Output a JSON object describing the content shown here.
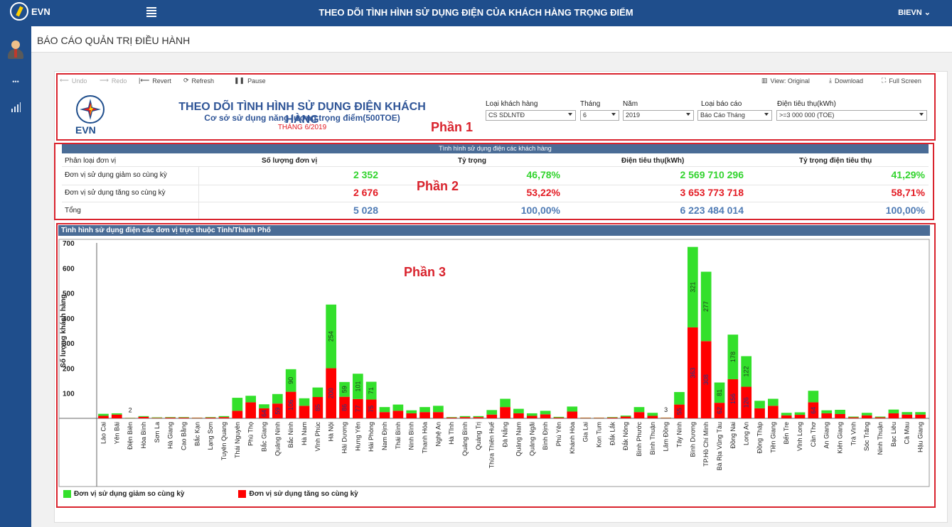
{
  "topbar": {
    "brand": "EVN",
    "app_title": "THEO DÕI TÌNH HÌNH SỬ DỤNG ĐIỆN CỦA KHÁCH HÀNG TRỌNG ĐIỂM",
    "user": "BIEVN",
    "user_caret": "⌄"
  },
  "sidebar": {
    "icons": [
      "user-avatar-icon",
      "ellipsis-icon",
      "bar-chart-icon"
    ],
    "glyph_more": "•••"
  },
  "page": {
    "heading": "BÁO CÁO QUẢN TRỊ ĐIỀU HÀNH"
  },
  "toolbar": {
    "undo": "Undo",
    "redo": "Redo",
    "revert": "Revert",
    "refresh": "Refresh",
    "pause": "Pause",
    "view": "View: Original",
    "download": "Download",
    "fullscreen": "Full Screen"
  },
  "report": {
    "logo_text": "EVN",
    "title": "THEO DÕI TÌNH HÌNH SỬ DỤNG ĐIỆN KHÁCH HÀNG",
    "subtitle": "Cơ sở sử dụng năng lượng trọng điểm(500TOE)",
    "month": "THÁNG 6/2019"
  },
  "annotations": {
    "part1": "Phần 1",
    "part2": "Phần 2",
    "part3": "Phần 3"
  },
  "filters": {
    "customer_type": {
      "label": "Loại khách hàng",
      "value": "CS SDLNTĐ"
    },
    "month": {
      "label": "Tháng",
      "value": "6"
    },
    "year": {
      "label": "Năm",
      "value": "2019"
    },
    "report_type": {
      "label": "Loại báo cáo",
      "value": "Báo Cáo Tháng"
    },
    "consumption": {
      "label": "Điện tiêu thụ(kWh)",
      "value": ">=3 000 000 (TOE)"
    }
  },
  "summary": {
    "header": "Tình hình sử dụng điện các khách hàng",
    "columns": [
      "Phân loại đơn vị",
      "Số lượng đơn vị",
      "Tỷ trọng",
      "Điện tiêu thụ(kWh)",
      "Tỷ trọng điện tiêu thụ"
    ],
    "rows": [
      {
        "label": "Đơn vị sử dụng giảm so cùng kỳ",
        "count": "2 352",
        "ratio": "46,78%",
        "energy": "2 569 710 296",
        "energy_ratio": "41,29%"
      },
      {
        "label": "Đơn vị sử dụng tăng so cùng kỳ",
        "count": "2 676",
        "ratio": "53,22%",
        "energy": "3 653 773 718",
        "energy_ratio": "58,71%"
      },
      {
        "label": "Tổng",
        "count": "5 028",
        "ratio": "100,00%",
        "energy": "6 223 484 014",
        "energy_ratio": "100,00%"
      }
    ]
  },
  "chart_section": {
    "header": "Tình hình sử dụng điện các đơn vị trực thuộc Tỉnh/Thành Phố"
  },
  "chart_data": {
    "type": "bar",
    "stacked": true,
    "title": "Tình hình sử dụng điện các đơn vị trực thuộc Tỉnh/Thành Phố",
    "ylabel": "Số lượng khách hàng",
    "ylim": [
      0,
      700
    ],
    "yticks": [
      100,
      200,
      300,
      400,
      500,
      600,
      700
    ],
    "categories": [
      "Lào Cai",
      "Yên Bái",
      "Điện Biên",
      "Hòa Bình",
      "Sơn La",
      "Hà Giang",
      "Cao Bằng",
      "Bắc Kạn",
      "Lạng Sơn",
      "Tuyên Quang",
      "Thái Nguyên",
      "Phú Thọ",
      "Bắc Giang",
      "Quảng Ninh",
      "Bắc Ninh",
      "Hà Nam",
      "Vĩnh Phúc",
      "Hà Nội",
      "Hải Dương",
      "Hưng Yên",
      "Hải Phòng",
      "Nam Định",
      "Thái Bình",
      "Ninh Bình",
      "Thanh Hóa",
      "Nghệ An",
      "Hà Tĩnh",
      "Quảng Bình",
      "Quảng Trị",
      "Thừa Thiên Huế",
      "Đà Nẵng",
      "Quảng Nam",
      "Quảng Ngãi",
      "Bình Định",
      "Phú Yên",
      "Khánh Hòa",
      "Gia Lai",
      "Kon Tum",
      "Đắk Lắk",
      "Đắk Nông",
      "Bình Phước",
      "Bình Thuận",
      "Lâm Đồng",
      "Tây Ninh",
      "Bình Dương",
      "TP.Hồ Chí Minh",
      "Bà Rịa Vũng Tàu",
      "Đồng Nai",
      "Long An",
      "Đồng Tháp",
      "Tiền Giang",
      "Bến Tre",
      "Vĩnh Long",
      "Cần Thơ",
      "An Giang",
      "Kiên Giang",
      "Trà Vinh",
      "Sóc Trăng",
      "Ninh Thuận",
      "Bạc Liêu",
      "Cà Mau",
      "Hậu Giang"
    ],
    "series": [
      {
        "name": "Đơn vị sử dụng tăng so cùng kỳ",
        "color": "#ff0000",
        "values": [
          10,
          15,
          1,
          6,
          2,
          3,
          3,
          2,
          3,
          5,
          30,
          64,
          40,
          59,
          106,
          50,
          85,
          200,
          86,
          77,
          75,
          25,
          30,
          20,
          25,
          25,
          3,
          5,
          5,
          15,
          45,
          20,
          10,
          16,
          3,
          27,
          2,
          2,
          3,
          7,
          25,
          10,
          2,
          55,
          363,
          308,
          62,
          156,
          126,
          40,
          50,
          12,
          14,
          64,
          20,
          17,
          4,
          12,
          4,
          20,
          15,
          15
        ]
      },
      {
        "name": "Đơn vị sử dụng giảm so cùng kỳ",
        "color": "#33e02b",
        "values": [
          8,
          5,
          1,
          3,
          2,
          2,
          2,
          1,
          2,
          4,
          52,
          26,
          16,
          38,
          90,
          30,
          38,
          254,
          59,
          101,
          71,
          20,
          25,
          12,
          20,
          25,
          2,
          4,
          4,
          18,
          33,
          18,
          10,
          14,
          3,
          20,
          1,
          1,
          2,
          4,
          20,
          12,
          1,
          50,
          321,
          277,
          81,
          178,
          122,
          30,
          28,
          10,
          10,
          46,
          12,
          17,
          3,
          10,
          3,
          15,
          10,
          10
        ]
      }
    ],
    "data_labels": {
      "increase": {
        "12": "64",
        "13": "59",
        "14": "106",
        "16": "85",
        "17": "200",
        "18": "86",
        "19": "77",
        "20": "75",
        "43": "55",
        "44": "363",
        "45": "308",
        "46": "62",
        "47": "156",
        "48": "126",
        "53": "64"
      },
      "decrease": {
        "14": "90",
        "17": "254",
        "18": "59",
        "19": "101",
        "20": "71",
        "44": "321",
        "45": "277",
        "46": "81",
        "47": "178",
        "48": "122"
      },
      "total": {
        "2": "2",
        "42": "3"
      }
    },
    "legend": "bottom-left",
    "grid": false
  }
}
